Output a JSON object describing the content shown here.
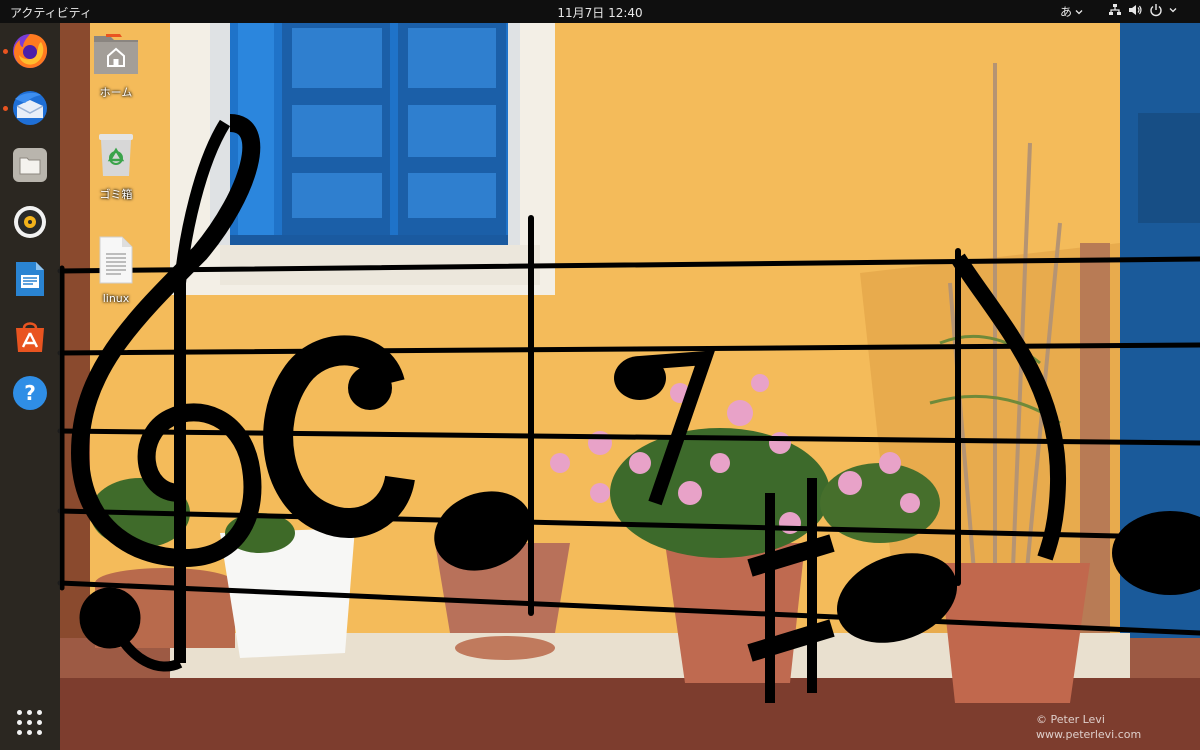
{
  "topbar": {
    "activities_label": "アクティビティ",
    "clock": "11月7日  12:40",
    "input_method": "あ"
  },
  "dock": {
    "items": [
      {
        "name": "Firefox",
        "icon": "firefox-icon",
        "running": true
      },
      {
        "name": "Thunderbird",
        "icon": "thunderbird-icon",
        "running": true
      },
      {
        "name": "Files",
        "icon": "files-icon",
        "running": false
      },
      {
        "name": "Rhythmbox",
        "icon": "rhythmbox-icon",
        "running": false
      },
      {
        "name": "LibreOffice Writer",
        "icon": "writer-icon",
        "running": false
      },
      {
        "name": "Ubuntu Software",
        "icon": "software-icon",
        "running": false
      },
      {
        "name": "Help",
        "icon": "help-icon",
        "running": false
      }
    ],
    "show_apps_icon": "apps-grid-icon"
  },
  "desktop": {
    "icons": [
      {
        "label": "ホーム",
        "icon": "home-folder-icon"
      },
      {
        "label": "ゴミ箱",
        "icon": "trash-icon"
      },
      {
        "label": "linux",
        "icon": "text-file-icon"
      }
    ],
    "watermark_line1": "© Peter Levi",
    "watermark_line2": "www.peterlevi.com"
  },
  "colors": {
    "accent": "#e95420",
    "wall": "#f0b44c",
    "window_blue": "#1d6fc8",
    "topbar": "#0f0f0f"
  }
}
